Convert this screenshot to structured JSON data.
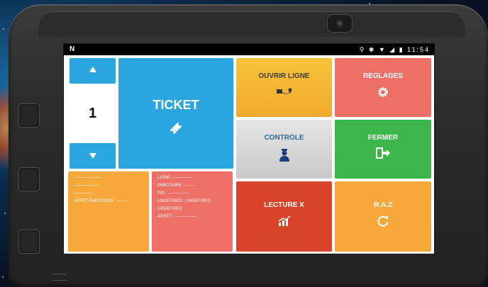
{
  "status_bar": {
    "app_icon": "N",
    "icons": "⚲ ✱ ▼ ◢ ▮",
    "time": "11:54"
  },
  "counter": {
    "up_icon": "arrow-up-icon",
    "value": "1",
    "down_icon": "arrow-down-icon"
  },
  "tiles": {
    "ticket": {
      "label": "TICKET",
      "color": "#2aa5df",
      "icon": "ticket-icon"
    },
    "ouvrir_ligne": {
      "label": "OUVRIR LIGNE",
      "color": "#f6c538",
      "icon": "route-icon"
    },
    "reglages": {
      "label": "REGLAGES",
      "color": "#ee6f66",
      "icon": "gear-icon"
    },
    "controle": {
      "label": "CONTROLE",
      "color": "#d6d6d6",
      "text_color": "#2f6a98",
      "icon": "inspector-icon"
    },
    "fermer": {
      "label": "FERMER",
      "color": "#3cb54a",
      "icon": "exit-door-icon"
    },
    "lecture_x": {
      "label": "LECTURE X",
      "color": "#d9432a",
      "icon": "chart-up-icon"
    },
    "raz": {
      "label": "R.A.Z",
      "color": "#f7a83a",
      "icon": "refresh-icon"
    }
  },
  "info_left": {
    "line1": "-------------------",
    "line2": "---/--------------",
    "line3": "--------------",
    "arret": "ARRÊT PARCOURS : ---------"
  },
  "info_right": {
    "ligne": "LIGNE : -------------",
    "parcours": "PARCOURS : --------",
    "pid": "PID : ---------------",
    "undefined": "UNDEFINED , UNDEFINED , UNDEFINED",
    "arret": "ARRÊT : ---------------"
  }
}
